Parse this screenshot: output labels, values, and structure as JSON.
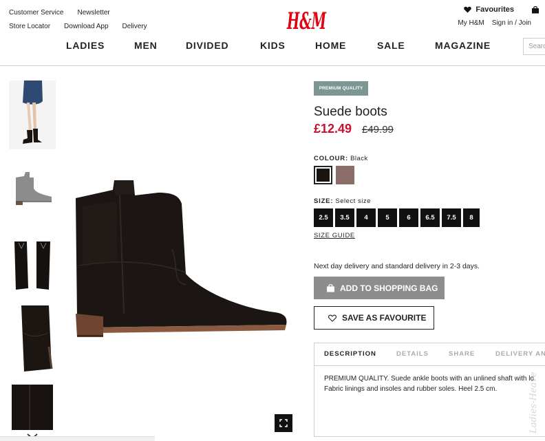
{
  "header": {
    "links_left_row1": [
      "Customer Service",
      "Newsletter"
    ],
    "links_left_row2": [
      "Store Locator",
      "Download App",
      "Delivery"
    ],
    "logo_text": "H&M",
    "favourites_label": "Favourites",
    "account_links": [
      "My H&M",
      "Sign in / Join"
    ],
    "nav": [
      "LADIES",
      "MEN",
      "DIVIDED",
      "KIDS",
      "HOME",
      "SALE",
      "MAGAZINE"
    ],
    "search_placeholder": "Search",
    "brand_color": "#e50010"
  },
  "product": {
    "badge": "PREMIUM QUALITY",
    "title": "Suede boots",
    "price_current": "£12.49",
    "price_original": "£49.99",
    "colour_label": "COLOUR:",
    "colour_value": "Black",
    "swatches": [
      {
        "name": "Black",
        "color": "#1a1410",
        "selected": true
      },
      {
        "name": "Mole",
        "color": "#8a6d68",
        "selected": false
      }
    ],
    "size_label": "SIZE:",
    "size_value": "Select size",
    "sizes": [
      "2.5",
      "3.5",
      "4",
      "5",
      "6",
      "6.5",
      "7.5",
      "8"
    ],
    "size_guide": "SIZE GUIDE",
    "delivery_note": "Next day delivery and standard delivery in 2-3 days.",
    "add_to_bag": "ADD TO SHOPPING BAG",
    "save_favourite": "SAVE AS FAVOURITE",
    "tabs": [
      "DESCRIPTION",
      "DETAILS",
      "SHARE",
      "DELIVERY AN"
    ],
    "description_lines": [
      "PREMIUM QUALITY. Suede ankle boots with an unlined shaft with lo",
      "Fabric linings and insoles and rubber soles. Heel 2.5 cm."
    ],
    "price_color": "#c8102e",
    "badge_color": "#7c9793"
  },
  "watermark": "Ladies-Heaven"
}
